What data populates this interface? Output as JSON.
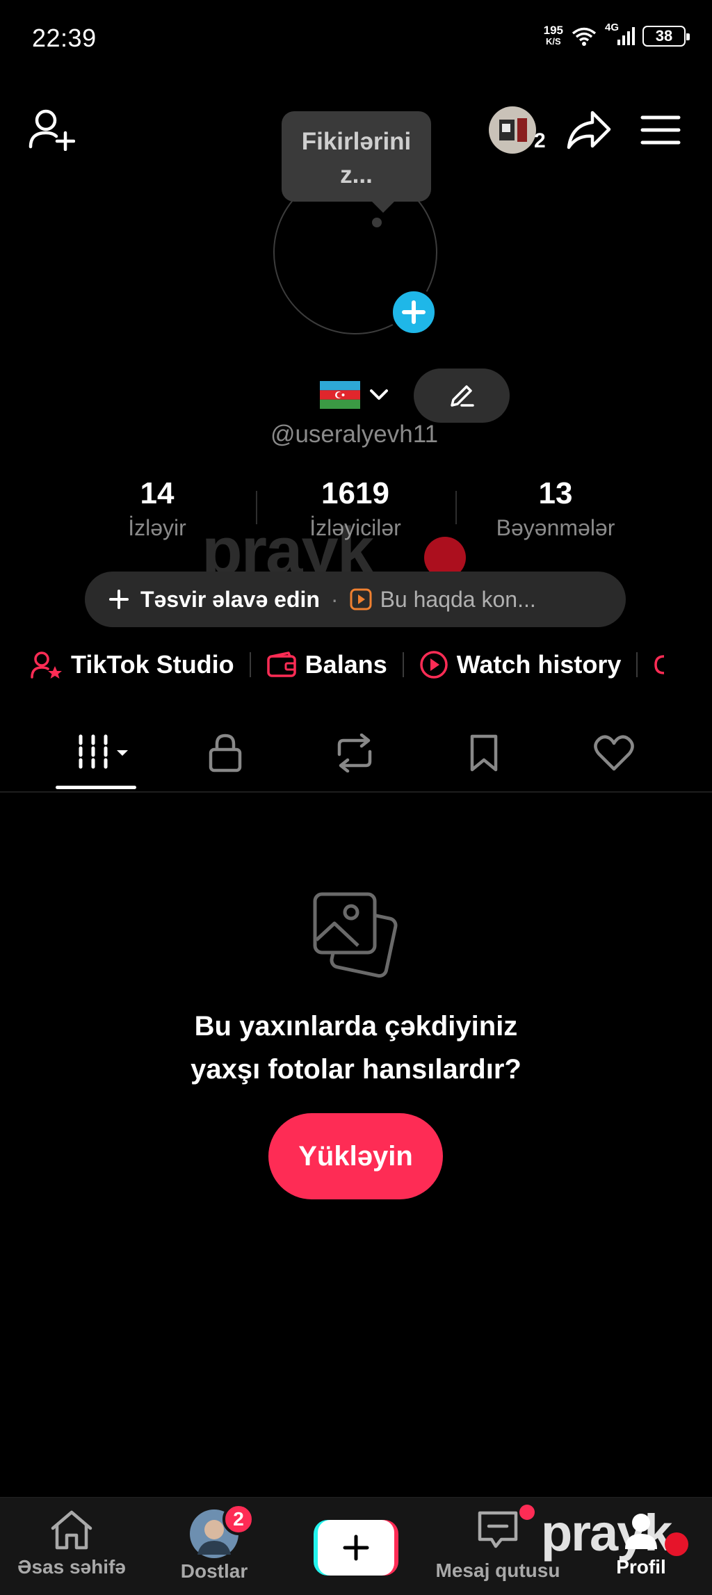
{
  "status_bar": {
    "time": "22:39",
    "speed_value": "195",
    "speed_unit": "K/S",
    "network": "4G",
    "battery": "38"
  },
  "header": {
    "story_count": "2"
  },
  "tooltip": {
    "text_line1": "Fikirlərini",
    "text_line2": "z..."
  },
  "profile": {
    "username": "@useralyevh11"
  },
  "stats": [
    {
      "value": "14",
      "label": "İzləyir"
    },
    {
      "value": "1619",
      "label": "İzləyicilər"
    },
    {
      "value": "13",
      "label": "Bəyənmələr"
    }
  ],
  "description": {
    "add_label": "Təsvir əlavə edin",
    "separator": "·",
    "about_label": "Bu haqda kon..."
  },
  "links": {
    "studio": "TikTok Studio",
    "balance": "Balans",
    "history": "Watch history"
  },
  "empty_state": {
    "line1": "Bu yaxınlarda çəkdiyiniz",
    "line2": "yaxşı fotolar hansılardır?",
    "button": "Yükləyin"
  },
  "nav": {
    "home": "Əsas səhifə",
    "friends": "Dostlar",
    "friends_badge": "2",
    "inbox": "Mesaj qutusu",
    "profile": "Profil"
  },
  "watermark": {
    "text": "prayk"
  },
  "colors": {
    "accent": "#fe2c55",
    "blue": "#1fb7e8",
    "muted": "#8a8a8a"
  }
}
